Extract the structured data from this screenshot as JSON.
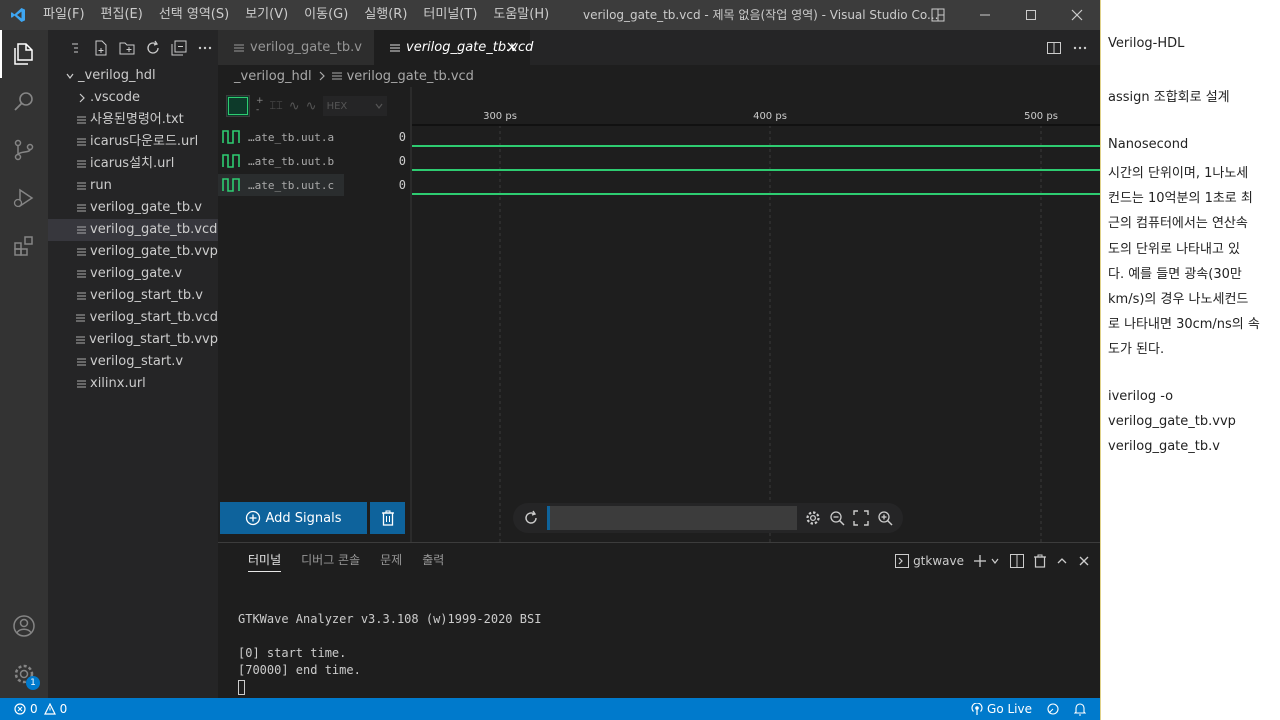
{
  "titlebar": {
    "menus": [
      "파일(F)",
      "편집(E)",
      "선택 영역(S)",
      "보기(V)",
      "이동(G)",
      "실행(R)",
      "터미널(T)",
      "도움말(H)"
    ],
    "window_title": "verilog_gate_tb.vcd - 제목 없음(작업 영역) - Visual Studio Co..."
  },
  "sidebar": {
    "root_folder": "_verilog_hdl",
    "items": [
      {
        "label": ".vscode",
        "kind": "folder"
      },
      {
        "label": "사용된명령어.txt",
        "kind": "file"
      },
      {
        "label": "icarus다운로드.url",
        "kind": "file"
      },
      {
        "label": "icarus설치.url",
        "kind": "file"
      },
      {
        "label": "run",
        "kind": "file"
      },
      {
        "label": "verilog_gate_tb.v",
        "kind": "file"
      },
      {
        "label": "verilog_gate_tb.vcd",
        "kind": "file",
        "selected": true
      },
      {
        "label": "verilog_gate_tb.vvp",
        "kind": "file"
      },
      {
        "label": "verilog_gate.v",
        "kind": "file"
      },
      {
        "label": "verilog_start_tb.v",
        "kind": "file"
      },
      {
        "label": "verilog_start_tb.vcd",
        "kind": "file"
      },
      {
        "label": "verilog_start_tb.vvp",
        "kind": "file"
      },
      {
        "label": "verilog_start.v",
        "kind": "file"
      },
      {
        "label": "xilinx.url",
        "kind": "file"
      }
    ]
  },
  "editor": {
    "tabs": [
      {
        "label": "verilog_gate_tb.v",
        "active": false
      },
      {
        "label": "verilog_gate_tb.vcd",
        "active": true
      }
    ],
    "breadcrumb": [
      "_verilog_hdl",
      "verilog_gate_tb.vcd"
    ]
  },
  "waveform": {
    "format_select": "HEX",
    "time_labels": [
      "300 ps",
      "400 ps",
      "500 ps"
    ],
    "signals": [
      {
        "name": "…ate_tb.uut.a",
        "value": "0"
      },
      {
        "name": "…ate_tb.uut.b",
        "value": "0"
      },
      {
        "name": "…ate_tb.uut.c",
        "value": "0"
      }
    ],
    "add_signals_label": "Add Signals",
    "wave_color": "#2ecc71"
  },
  "panel": {
    "tabs": [
      "터미널",
      "디버그 콘솔",
      "문제",
      "출력"
    ],
    "active_tab": "터미널",
    "terminal_name": "gtkwave",
    "terminal_lines": [
      "GTKWave Analyzer v3.3.108 (w)1999-2020 BSI",
      "",
      "[0] start time.",
      "[70000] end time."
    ]
  },
  "statusbar": {
    "errors": "0",
    "warnings": "0",
    "go_live": "Go Live"
  },
  "activity": {
    "settings_badge": "1"
  },
  "notes": {
    "lines": [
      "Verilog-HDL",
      "",
      "assign 조합회로 설계",
      "",
      "Nanosecond",
      "시간의 단위이며, 1나노세",
      "컨드는 10억분의 1초로 최",
      "근의 컴퓨터에서는 연산속",
      "도의 단위로 나타내고 있",
      "다. 예를 들면 광속(30만",
      "km/s)의 경우 나노세컨드",
      "로 나타내면 30cm/ns의 속",
      "도가 된다.",
      "",
      "iverilog -o",
      "verilog_gate_tb.vvp",
      "verilog_gate_tb.v"
    ]
  },
  "colors": {
    "accent": "#007acc",
    "button": "#0e639c",
    "wave": "#2ecc71"
  }
}
